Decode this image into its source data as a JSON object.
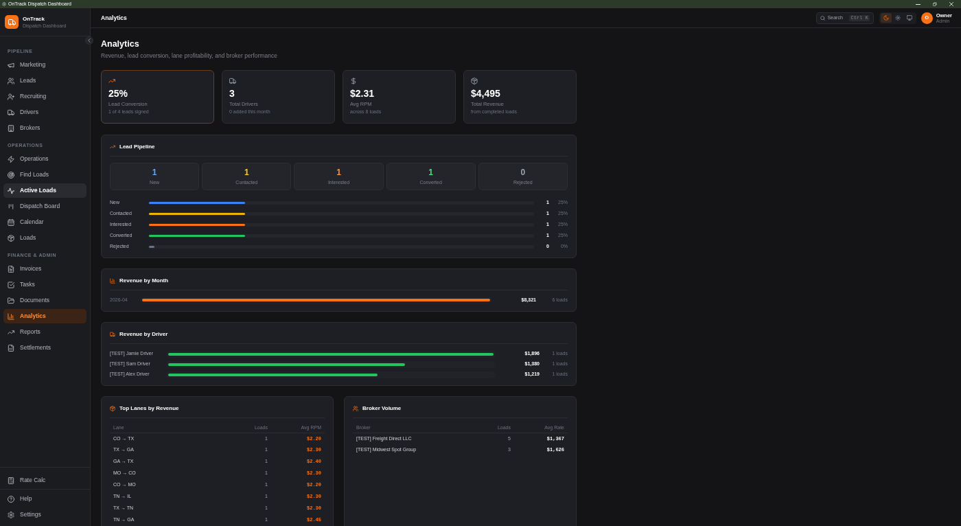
{
  "window": {
    "title": "OnTrack Dispatch Dashboard"
  },
  "sidebar": {
    "brand": {
      "name": "OnTrack",
      "tagline": "Dispatch Dashboard"
    },
    "sections": [
      {
        "heading": "PIPELINE",
        "items": [
          {
            "label": "Marketing",
            "selected": false,
            "hovered": false
          },
          {
            "label": "Leads",
            "selected": false,
            "hovered": false
          },
          {
            "label": "Recruiting",
            "selected": false,
            "hovered": false
          },
          {
            "label": "Drivers",
            "selected": false,
            "hovered": false
          },
          {
            "label": "Brokers",
            "selected": false,
            "hovered": false
          }
        ]
      },
      {
        "heading": "OPERATIONS",
        "items": [
          {
            "label": "Operations",
            "selected": false,
            "hovered": false
          },
          {
            "label": "Find Loads",
            "selected": false,
            "hovered": false
          },
          {
            "label": "Active Loads",
            "selected": false,
            "hovered": true
          },
          {
            "label": "Dispatch Board",
            "selected": false,
            "hovered": false
          },
          {
            "label": "Calendar",
            "selected": false,
            "hovered": false
          },
          {
            "label": "Loads",
            "selected": false,
            "hovered": false
          }
        ]
      },
      {
        "heading": "FINANCE & ADMIN",
        "items": [
          {
            "label": "Invoices",
            "selected": false,
            "hovered": false
          },
          {
            "label": "Tasks",
            "selected": false,
            "hovered": false
          },
          {
            "label": "Documents",
            "selected": false,
            "hovered": false
          },
          {
            "label": "Analytics",
            "selected": true,
            "hovered": false
          },
          {
            "label": "Reports",
            "selected": false,
            "hovered": false
          },
          {
            "label": "Settlements",
            "selected": false,
            "hovered": false
          }
        ]
      }
    ],
    "footer_groups": [
      {
        "items": [
          {
            "label": "Rate Calc",
            "selected": false,
            "hovered": false
          }
        ]
      },
      {
        "items": [
          {
            "label": "Help",
            "selected": false,
            "hovered": false
          },
          {
            "label": "Settings",
            "selected": false,
            "hovered": false
          }
        ]
      }
    ]
  },
  "topbar": {
    "title": "Analytics",
    "search": {
      "placeholder": "Search",
      "shortcut": "Ctrl K"
    },
    "theme_options": [
      {
        "kind": "dark",
        "selected": true
      },
      {
        "kind": "light",
        "selected": false
      },
      {
        "kind": "system",
        "selected": false
      }
    ],
    "user": {
      "initial": "O",
      "name": "Owner",
      "role": "Admin"
    }
  },
  "page": {
    "heading": "Analytics",
    "subtitle": "Revenue, lead conversion, lane profitability, and broker performance"
  },
  "stats": [
    {
      "value": "25%",
      "label": "Lead Conversion",
      "note": "1 of 4 leads signed",
      "highlighted": true
    },
    {
      "value": "3",
      "label": "Total Drivers",
      "note": "0 added this month",
      "highlighted": false
    },
    {
      "value": "$2.31",
      "label": "Avg RPM",
      "note": "across 8 loads",
      "highlighted": false
    },
    {
      "value": "$4,495",
      "label": "Total Revenue",
      "note": "from completed loads",
      "highlighted": false
    }
  ],
  "lead_pipeline": {
    "title": "Lead Pipeline",
    "stage_counts": [
      {
        "count": "1",
        "label": "New",
        "color": "#60a5fa"
      },
      {
        "count": "1",
        "label": "Contacted",
        "color": "#facc15"
      },
      {
        "count": "1",
        "label": "Interested",
        "color": "#fb923c"
      },
      {
        "count": "1",
        "label": "Converted",
        "color": "#4ade80"
      },
      {
        "count": "0",
        "label": "Rejected",
        "color": "#9ca3af"
      }
    ],
    "stage_bars": [
      {
        "label": "New",
        "level": 0.25,
        "count": "1",
        "percent": "25%",
        "color": "#3b82f6"
      },
      {
        "label": "Contacted",
        "level": 0.25,
        "count": "1",
        "percent": "25%",
        "color": "#eab308"
      },
      {
        "label": "Interested",
        "level": 0.25,
        "count": "1",
        "percent": "25%",
        "color": "#f97316"
      },
      {
        "label": "Converted",
        "level": 0.25,
        "count": "1",
        "percent": "25%",
        "color": "#22c55e"
      },
      {
        "label": "Rejected",
        "level": 0,
        "count": "0",
        "percent": "0%",
        "color": "#6b7280"
      }
    ]
  },
  "revenue_by_month": {
    "title": "Revenue by Month",
    "rows": [
      {
        "month": "2026-04",
        "level": 1,
        "amount": "$8,321",
        "loads": "6 loads"
      }
    ]
  },
  "revenue_by_driver": {
    "title": "Revenue by Driver",
    "rows": [
      {
        "name": "[TEST] Jamie Driver",
        "level": 1,
        "amount": "$1,896",
        "loads": "1 loads"
      },
      {
        "name": "[TEST] Sam Driver",
        "level": 0.728,
        "amount": "$1,380",
        "loads": "1 loads"
      },
      {
        "name": "[TEST] Alex Driver",
        "level": 0.643,
        "amount": "$1,219",
        "loads": "1 loads"
      }
    ]
  },
  "top_lanes": {
    "title": "Top Lanes by Revenue",
    "columns": [
      "Lane",
      "Loads",
      "Avg RPM"
    ],
    "rows": [
      [
        "CO → TX",
        "1",
        "$2.20"
      ],
      [
        "TX → GA",
        "1",
        "$2.30"
      ],
      [
        "GA → TX",
        "1",
        "$2.40"
      ],
      [
        "MO → CO",
        "1",
        "$2.30"
      ],
      [
        "CO → MO",
        "1",
        "$2.20"
      ],
      [
        "TN → IL",
        "1",
        "$2.30"
      ],
      [
        "TX → TN",
        "1",
        "$2.30"
      ],
      [
        "TN → GA",
        "1",
        "$2.45"
      ]
    ]
  },
  "broker_volume": {
    "title": "Broker Volume",
    "columns": [
      "Broker",
      "Loads",
      "Avg Rate"
    ],
    "rows": [
      [
        "[TEST] Freight Direct LLC",
        "5",
        "$1,367"
      ],
      [
        "[TEST] Midwest Spot Group",
        "3",
        "$1,626"
      ]
    ]
  }
}
